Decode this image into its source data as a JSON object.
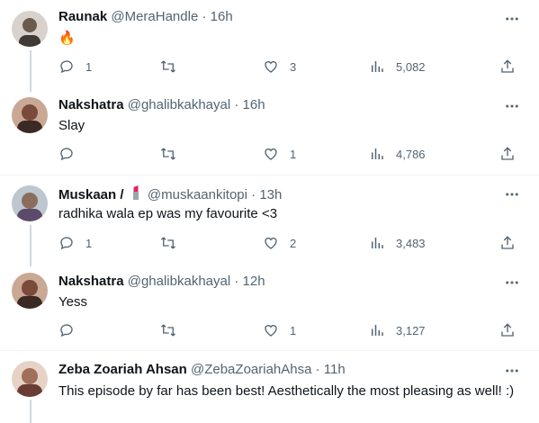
{
  "tweets": [
    {
      "name": "Raunak",
      "handle": "@MeraHandle",
      "time": "16h",
      "text": "🔥",
      "replies": "1",
      "retweets": "",
      "likes": "3",
      "views": "5,082",
      "avatar_color": "#6b5a4e"
    },
    {
      "name": "Nakshatra",
      "handle": "@ghalibkakhayal",
      "time": "16h",
      "text": "Slay",
      "replies": "",
      "retweets": "",
      "likes": "1",
      "views": "4,786",
      "avatar_color": "#7a4b3a"
    },
    {
      "name": "Muskaan /",
      "handle": "@muskaankitopi",
      "time": "13h",
      "text": "radhika wala ep was my favourite <3",
      "replies": "1",
      "retweets": "",
      "likes": "2",
      "views": "3,483",
      "avatar_color": "#8a6d5c"
    },
    {
      "name": "Nakshatra",
      "handle": "@ghalibkakhayal",
      "time": "12h",
      "text": "Yess",
      "replies": "",
      "retweets": "",
      "likes": "1",
      "views": "3,127",
      "avatar_color": "#7a4b3a"
    },
    {
      "name": "Zeba Zoariah Ahsan",
      "handle": "@ZebaZoariahAhsa",
      "time": "11h",
      "text": "This episode by far has been best! Aesthetically the most pleasing as well! :)",
      "avatar_color": "#a0705a"
    }
  ],
  "separator": "·",
  "colors": {
    "text_primary": "#0f1419",
    "text_secondary": "#536471",
    "thread_line": "#cfd9de",
    "divider": "#eff3f4"
  },
  "icons": [
    "reply-icon",
    "retweet-icon",
    "like-icon",
    "views-icon",
    "share-icon",
    "more-icon",
    "lipstick-icon"
  ]
}
